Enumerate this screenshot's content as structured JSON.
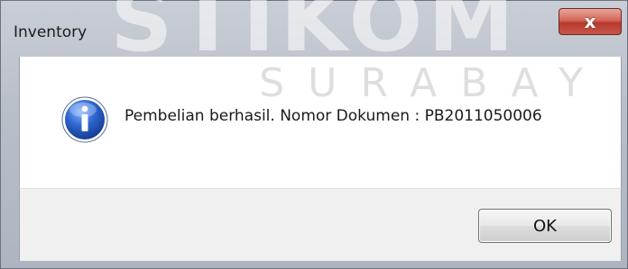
{
  "window": {
    "title": "Inventory",
    "close_label": "x"
  },
  "dialog": {
    "icon": "information-icon",
    "message": "Pembelian berhasil. Nomor Dokumen : PB2011050006",
    "ok_label": "OK"
  },
  "watermark": {
    "top_text": "STIKOM",
    "mid_text": "SURABAY"
  },
  "colors": {
    "frame": "#b9bfc9",
    "close_button": "#c5574a",
    "info_blue": "#1f4fb8",
    "content_bg": "#ffffff",
    "footer_bg": "#f0f0f0"
  }
}
